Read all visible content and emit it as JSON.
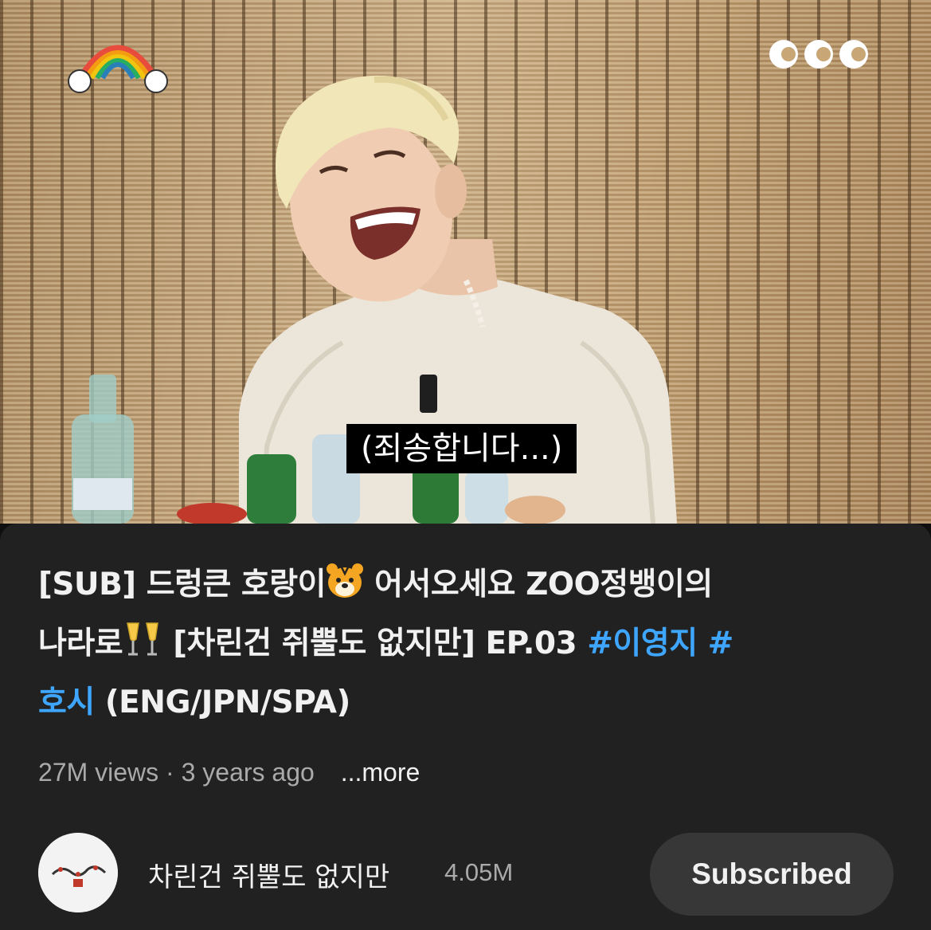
{
  "video": {
    "subtitle": "(죄송합니다...)",
    "show_logo_icon": "rainbow-logo-icon",
    "channel_watermark_icon": "ccc-watermark-icon"
  },
  "info": {
    "title_lines": [
      {
        "text": "[SUB] 드렁큰 호랑이",
        "emoji": "tiger-face-icon",
        "text_after": " 어서오세요 ZOO정뱅이의"
      },
      {
        "text": "나라로",
        "emoji": "clinking-glasses-icon",
        "text_after": " [차린건 쥐뿔도 없지만] EP.03 ",
        "hashtag": "#이영지 #"
      },
      {
        "hashtag": "호시",
        "text_after": " (ENG/JPN/SPA)"
      }
    ],
    "views": "27M views",
    "separator": "·",
    "age": "3 years ago",
    "more_label": "...more"
  },
  "channel": {
    "name": "차린건 쥐뿔도 없지만",
    "subscribers": "4.05M",
    "subscribe_label": "Subscribed"
  },
  "colors": {
    "background": "#0f0f0f",
    "card": "#212121",
    "hashtag": "#3ea6ff",
    "button": "#373737"
  }
}
